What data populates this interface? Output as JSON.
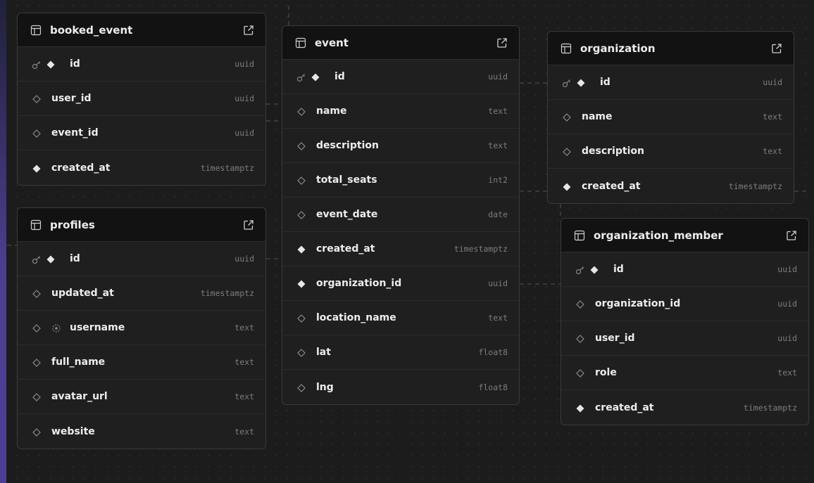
{
  "tables": [
    {
      "id": "booked_event",
      "name": "booked_event",
      "columns": [
        {
          "name": "id",
          "type": "uuid",
          "primary": true,
          "nullable": false
        },
        {
          "name": "user_id",
          "type": "uuid",
          "primary": false,
          "nullable": true
        },
        {
          "name": "event_id",
          "type": "uuid",
          "primary": false,
          "nullable": true
        },
        {
          "name": "created_at",
          "type": "timestamptz",
          "primary": false,
          "nullable": false
        }
      ]
    },
    {
      "id": "profiles",
      "name": "profiles",
      "columns": [
        {
          "name": "id",
          "type": "uuid",
          "primary": true,
          "nullable": false
        },
        {
          "name": "updated_at",
          "type": "timestamptz",
          "primary": false,
          "nullable": true
        },
        {
          "name": "username",
          "type": "text",
          "primary": false,
          "nullable": true,
          "identity": true
        },
        {
          "name": "full_name",
          "type": "text",
          "primary": false,
          "nullable": true
        },
        {
          "name": "avatar_url",
          "type": "text",
          "primary": false,
          "nullable": true
        },
        {
          "name": "website",
          "type": "text",
          "primary": false,
          "nullable": true
        }
      ]
    },
    {
      "id": "event",
      "name": "event",
      "columns": [
        {
          "name": "id",
          "type": "uuid",
          "primary": true,
          "nullable": false
        },
        {
          "name": "name",
          "type": "text",
          "primary": false,
          "nullable": true
        },
        {
          "name": "description",
          "type": "text",
          "primary": false,
          "nullable": true
        },
        {
          "name": "total_seats",
          "type": "int2",
          "primary": false,
          "nullable": true
        },
        {
          "name": "event_date",
          "type": "date",
          "primary": false,
          "nullable": true
        },
        {
          "name": "created_at",
          "type": "timestamptz",
          "primary": false,
          "nullable": false
        },
        {
          "name": "organization_id",
          "type": "uuid",
          "primary": false,
          "nullable": false
        },
        {
          "name": "location_name",
          "type": "text",
          "primary": false,
          "nullable": true
        },
        {
          "name": "lat",
          "type": "float8",
          "primary": false,
          "nullable": true
        },
        {
          "name": "lng",
          "type": "float8",
          "primary": false,
          "nullable": true
        }
      ]
    },
    {
      "id": "organization",
      "name": "organization",
      "columns": [
        {
          "name": "id",
          "type": "uuid",
          "primary": true,
          "nullable": false
        },
        {
          "name": "name",
          "type": "text",
          "primary": false,
          "nullable": true
        },
        {
          "name": "description",
          "type": "text",
          "primary": false,
          "nullable": true
        },
        {
          "name": "created_at",
          "type": "timestamptz",
          "primary": false,
          "nullable": false
        }
      ]
    },
    {
      "id": "organization_member",
      "name": "organization_member",
      "columns": [
        {
          "name": "id",
          "type": "uuid",
          "primary": true,
          "nullable": false
        },
        {
          "name": "organization_id",
          "type": "uuid",
          "primary": false,
          "nullable": true
        },
        {
          "name": "user_id",
          "type": "uuid",
          "primary": false,
          "nullable": true
        },
        {
          "name": "role",
          "type": "text",
          "primary": false,
          "nullable": true
        },
        {
          "name": "created_at",
          "type": "timestamptz",
          "primary": false,
          "nullable": false
        }
      ]
    }
  ],
  "colors": {
    "canvas": "#1c1c1c",
    "table_header": "#121212",
    "table_body": "#1f1f1f",
    "text": "#ededed",
    "muted": "#7d7d7d"
  }
}
